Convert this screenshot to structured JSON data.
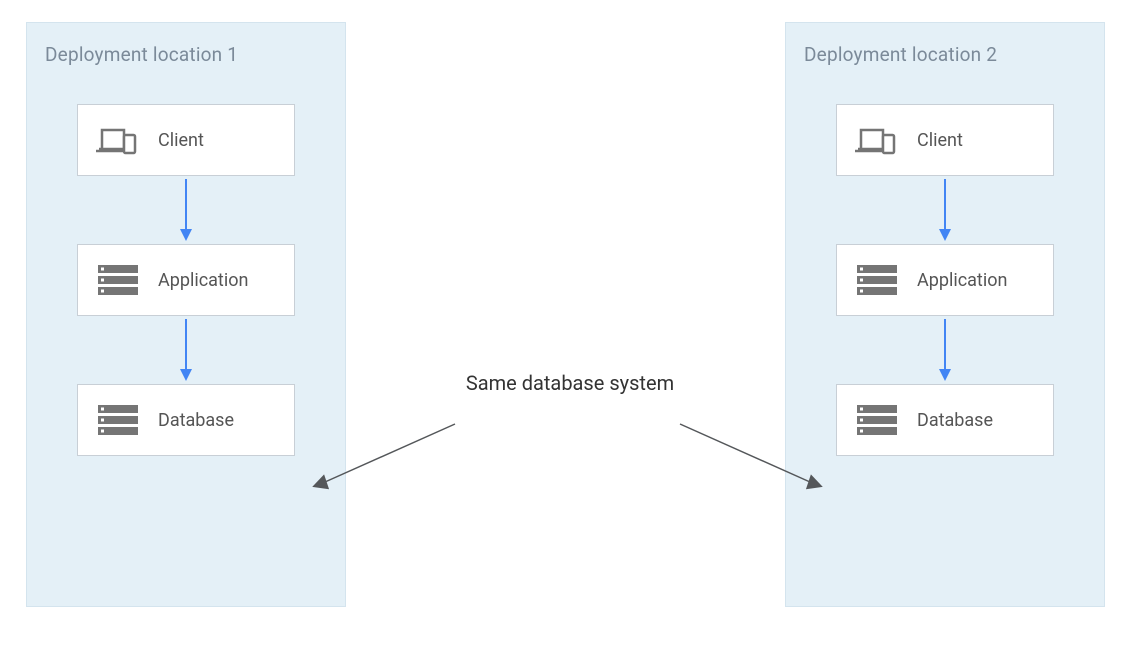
{
  "locations": [
    {
      "title": "Deployment location 1",
      "nodes": [
        {
          "label": "Client",
          "icon": "client"
        },
        {
          "label": "Application",
          "icon": "server"
        },
        {
          "label": "Database",
          "icon": "server"
        }
      ]
    },
    {
      "title": "Deployment location 2",
      "nodes": [
        {
          "label": "Client",
          "icon": "client"
        },
        {
          "label": "Application",
          "icon": "server"
        },
        {
          "label": "Database",
          "icon": "server"
        }
      ]
    }
  ],
  "center_annotation": "Same database system",
  "colors": {
    "zone_bg": "#e4f0f7",
    "node_border": "#c8cfd6",
    "arrow_blue": "#4285f4",
    "arrow_dark": "#54575a",
    "icon_gray": "#757575"
  }
}
